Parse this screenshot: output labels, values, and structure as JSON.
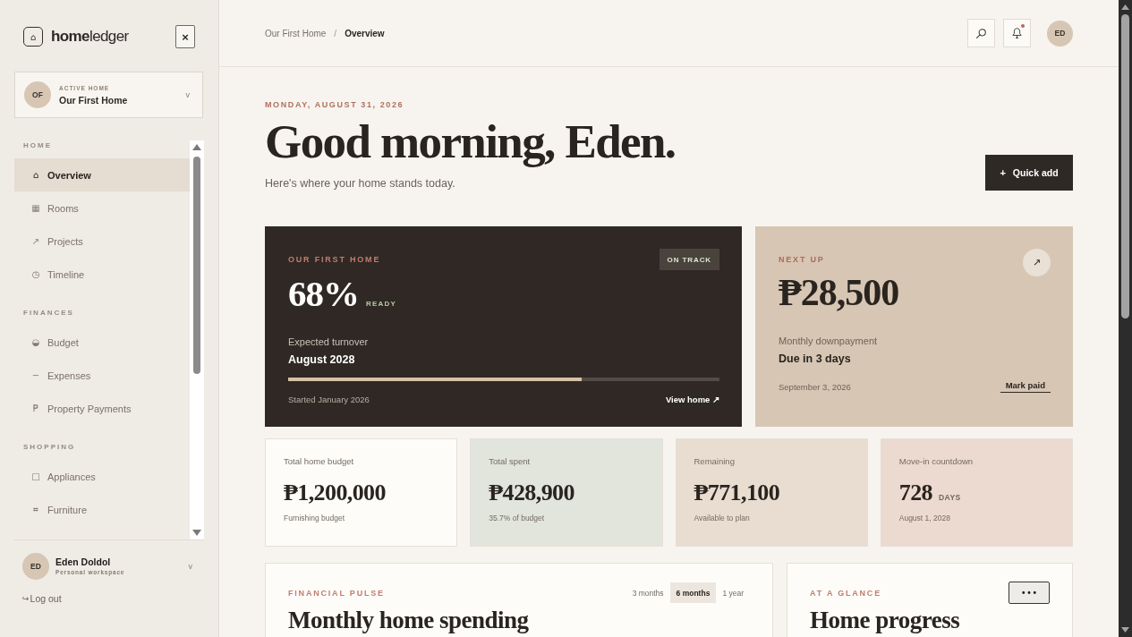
{
  "sidebar": {
    "logo": {
      "icon": "⌂",
      "name": "**home**ledger"
    },
    "close_button": "×",
    "active_home": {
      "initials": "OF",
      "label": "ACTIVE HOME",
      "name": "Our First Home",
      "caret": "v"
    },
    "sections": [
      {
        "title": "HOME",
        "items": [
          {
            "icon": "⌂",
            "label": "Overview",
            "selected": true
          },
          {
            "icon": "▦",
            "label": "Rooms",
            "selected": false
          },
          {
            "icon": "↗",
            "label": "Projects",
            "selected": false
          },
          {
            "icon": "◷",
            "label": "Timeline",
            "selected": false
          }
        ]
      },
      {
        "title": "FINANCES",
        "items": [
          {
            "icon": "◒",
            "label": "Budget",
            "selected": false
          },
          {
            "icon": "−",
            "label": "Expenses",
            "selected": false
          },
          {
            "icon": "₱",
            "label": "Property Payments",
            "selected": false
          }
        ]
      },
      {
        "title": "SHOPPING",
        "items": [
          {
            "icon": "□",
            "label": "Appliances",
            "selected": false
          },
          {
            "icon": "⌗",
            "label": "Furniture",
            "selected": false
          }
        ]
      }
    ],
    "user": {
      "initials": "ED",
      "name": "Eden Doldol",
      "subtitle": "Personal workspace",
      "caret": "v"
    },
    "logout": {
      "icon": "↪",
      "label": "Log out"
    }
  },
  "header": {
    "breadcrumbs": [
      {
        "label": "Our First Home",
        "current": false
      },
      {
        "label": "Overview",
        "current": true
      }
    ],
    "separator": "/",
    "notification": true,
    "avatar": "ED"
  },
  "greeting": {
    "date": "MONDAY, AUGUST 31, 2026",
    "title": "Good morning, Eden.",
    "subtitle": "Here's where your home stands today.",
    "quick_add": {
      "icon": "+",
      "label": "Quick add"
    }
  },
  "hero": {
    "eyebrow": "OUR FIRST HOME",
    "badge": "ON TRACK",
    "percent": "68%",
    "percent_label": "READY",
    "turnover_label": "Expected turnover",
    "turnover_value": "August 2028",
    "level": 0.68,
    "started": "Started January 2026",
    "link": "View home ↗"
  },
  "next_up": {
    "eyebrow": "NEXT UP",
    "arrow": "↗",
    "amount": "₱28,500",
    "label": "Monthly downpayment",
    "due": "Due in 3 days",
    "date": "September 3, 2026",
    "action": "Mark paid"
  },
  "stats": [
    {
      "label": "Total home budget",
      "value": "₱1,200,000",
      "note": "Furnishing budget",
      "color": "#fdfcf9"
    },
    {
      "label": "Total spent",
      "value": "₱428,900",
      "note": "35.7% of budget",
      "color": "#e1e5dc"
    },
    {
      "label": "Remaining",
      "value": "₱771,100",
      "note": "Available to plan",
      "color": "#e9ddd1"
    },
    {
      "label": "Move-in countdown",
      "value": "728",
      "unit": "DAYS",
      "note": "August 1, 2028",
      "color": "#ecd9cf"
    }
  ],
  "pulse": {
    "eyebrow": "FINANCIAL PULSE",
    "title": "Monthly home spending",
    "ranges": [
      {
        "label": "3 months",
        "selected": false
      },
      {
        "label": "6 months",
        "selected": true
      },
      {
        "label": "1 year",
        "selected": false
      }
    ]
  },
  "glance": {
    "eyebrow": "AT A GLANCE",
    "title": "Home progress",
    "more": "• • •"
  }
}
